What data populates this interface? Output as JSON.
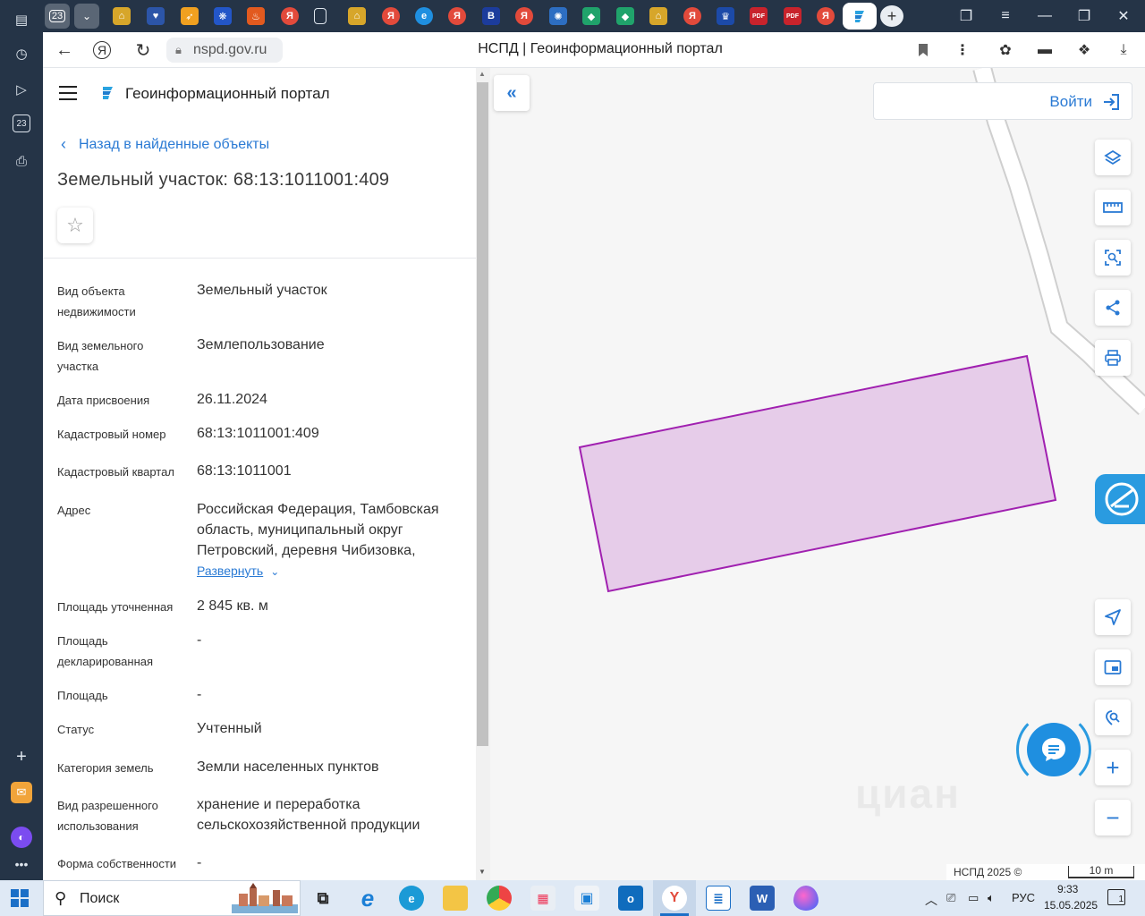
{
  "browser": {
    "tab_counter": "23",
    "url": "nspd.gov.ru",
    "page_title": "НСПД | Геоинформационный портал",
    "tab_favicons": [
      "gov-building-icon",
      "heart-icon",
      "fire-icon",
      "ya-icon",
      "doc-icon",
      "gov-building-icon",
      "ya-icon",
      "edge-icon",
      "ya-icon",
      "b-icon",
      "ya-icon",
      "globe-icon",
      "shield-icon",
      "gov-building-icon",
      "ya-icon",
      "eagle-icon",
      "pdf-icon",
      "pdf-icon",
      "ya-icon",
      "nspd-icon"
    ],
    "pdf_label": "PDF",
    "ya_label": "Я",
    "b_label": "B"
  },
  "app": {
    "portal_name": "Геоинформационный портал",
    "back_link": "Назад в найденные объекты",
    "object_title": "Земельный участок: 68:13:1011001:409"
  },
  "properties": [
    {
      "label": "Вид объекта недвижимости",
      "value": "Земельный участок"
    },
    {
      "label": "Вид земельного участка",
      "value": "Землепользование"
    },
    {
      "label": "Дата присвоения",
      "value": "26.11.2024"
    },
    {
      "label": "Кадастровый номер",
      "value": "68:13:1011001:409"
    },
    {
      "label": "Кадастровый квартал",
      "value": "68:13:1011001"
    },
    {
      "label": "Адрес",
      "value": "Российская Федерация, Тамбовская область, муниципальный округ Петровский, деревня Чибизовка,"
    },
    {
      "label": "Площадь уточненная",
      "value": "2 845 кв. м"
    },
    {
      "label": "Площадь декларированная",
      "value": "-"
    },
    {
      "label": "Площадь",
      "value": "-"
    },
    {
      "label": "Статус",
      "value": "Учтенный"
    },
    {
      "label": "Категория земель",
      "value": "Земли населенных пунктов"
    },
    {
      "label": "Вид разрешенного использования",
      "value": "хранение и переработка сельскохозяйственной продукции"
    },
    {
      "label": "Форма собственности",
      "value": "-"
    }
  ],
  "expand_link": "Развернуть",
  "map": {
    "login_label": "Войти",
    "attribution": "НСПД 2025 ©",
    "scale_label": "10 m",
    "watermark": "циан",
    "parcel_fill": "#e6cce9",
    "parcel_stroke": "#a020b0",
    "tools": [
      "layers-icon",
      "ruler-icon",
      "select-area-icon",
      "share-icon",
      "print-icon"
    ],
    "tools_bottom": [
      "locate-icon",
      "minimap-icon",
      "search-location-icon",
      "zoom-in-icon",
      "zoom-out-icon"
    ]
  },
  "taskbar": {
    "search_label": "Поиск",
    "lang": "РУС",
    "time": "9:33",
    "date": "15.05.2025",
    "notifications": "1"
  },
  "colors": {
    "accent": "#2a7ad4",
    "chrome_dark": "#253447"
  }
}
